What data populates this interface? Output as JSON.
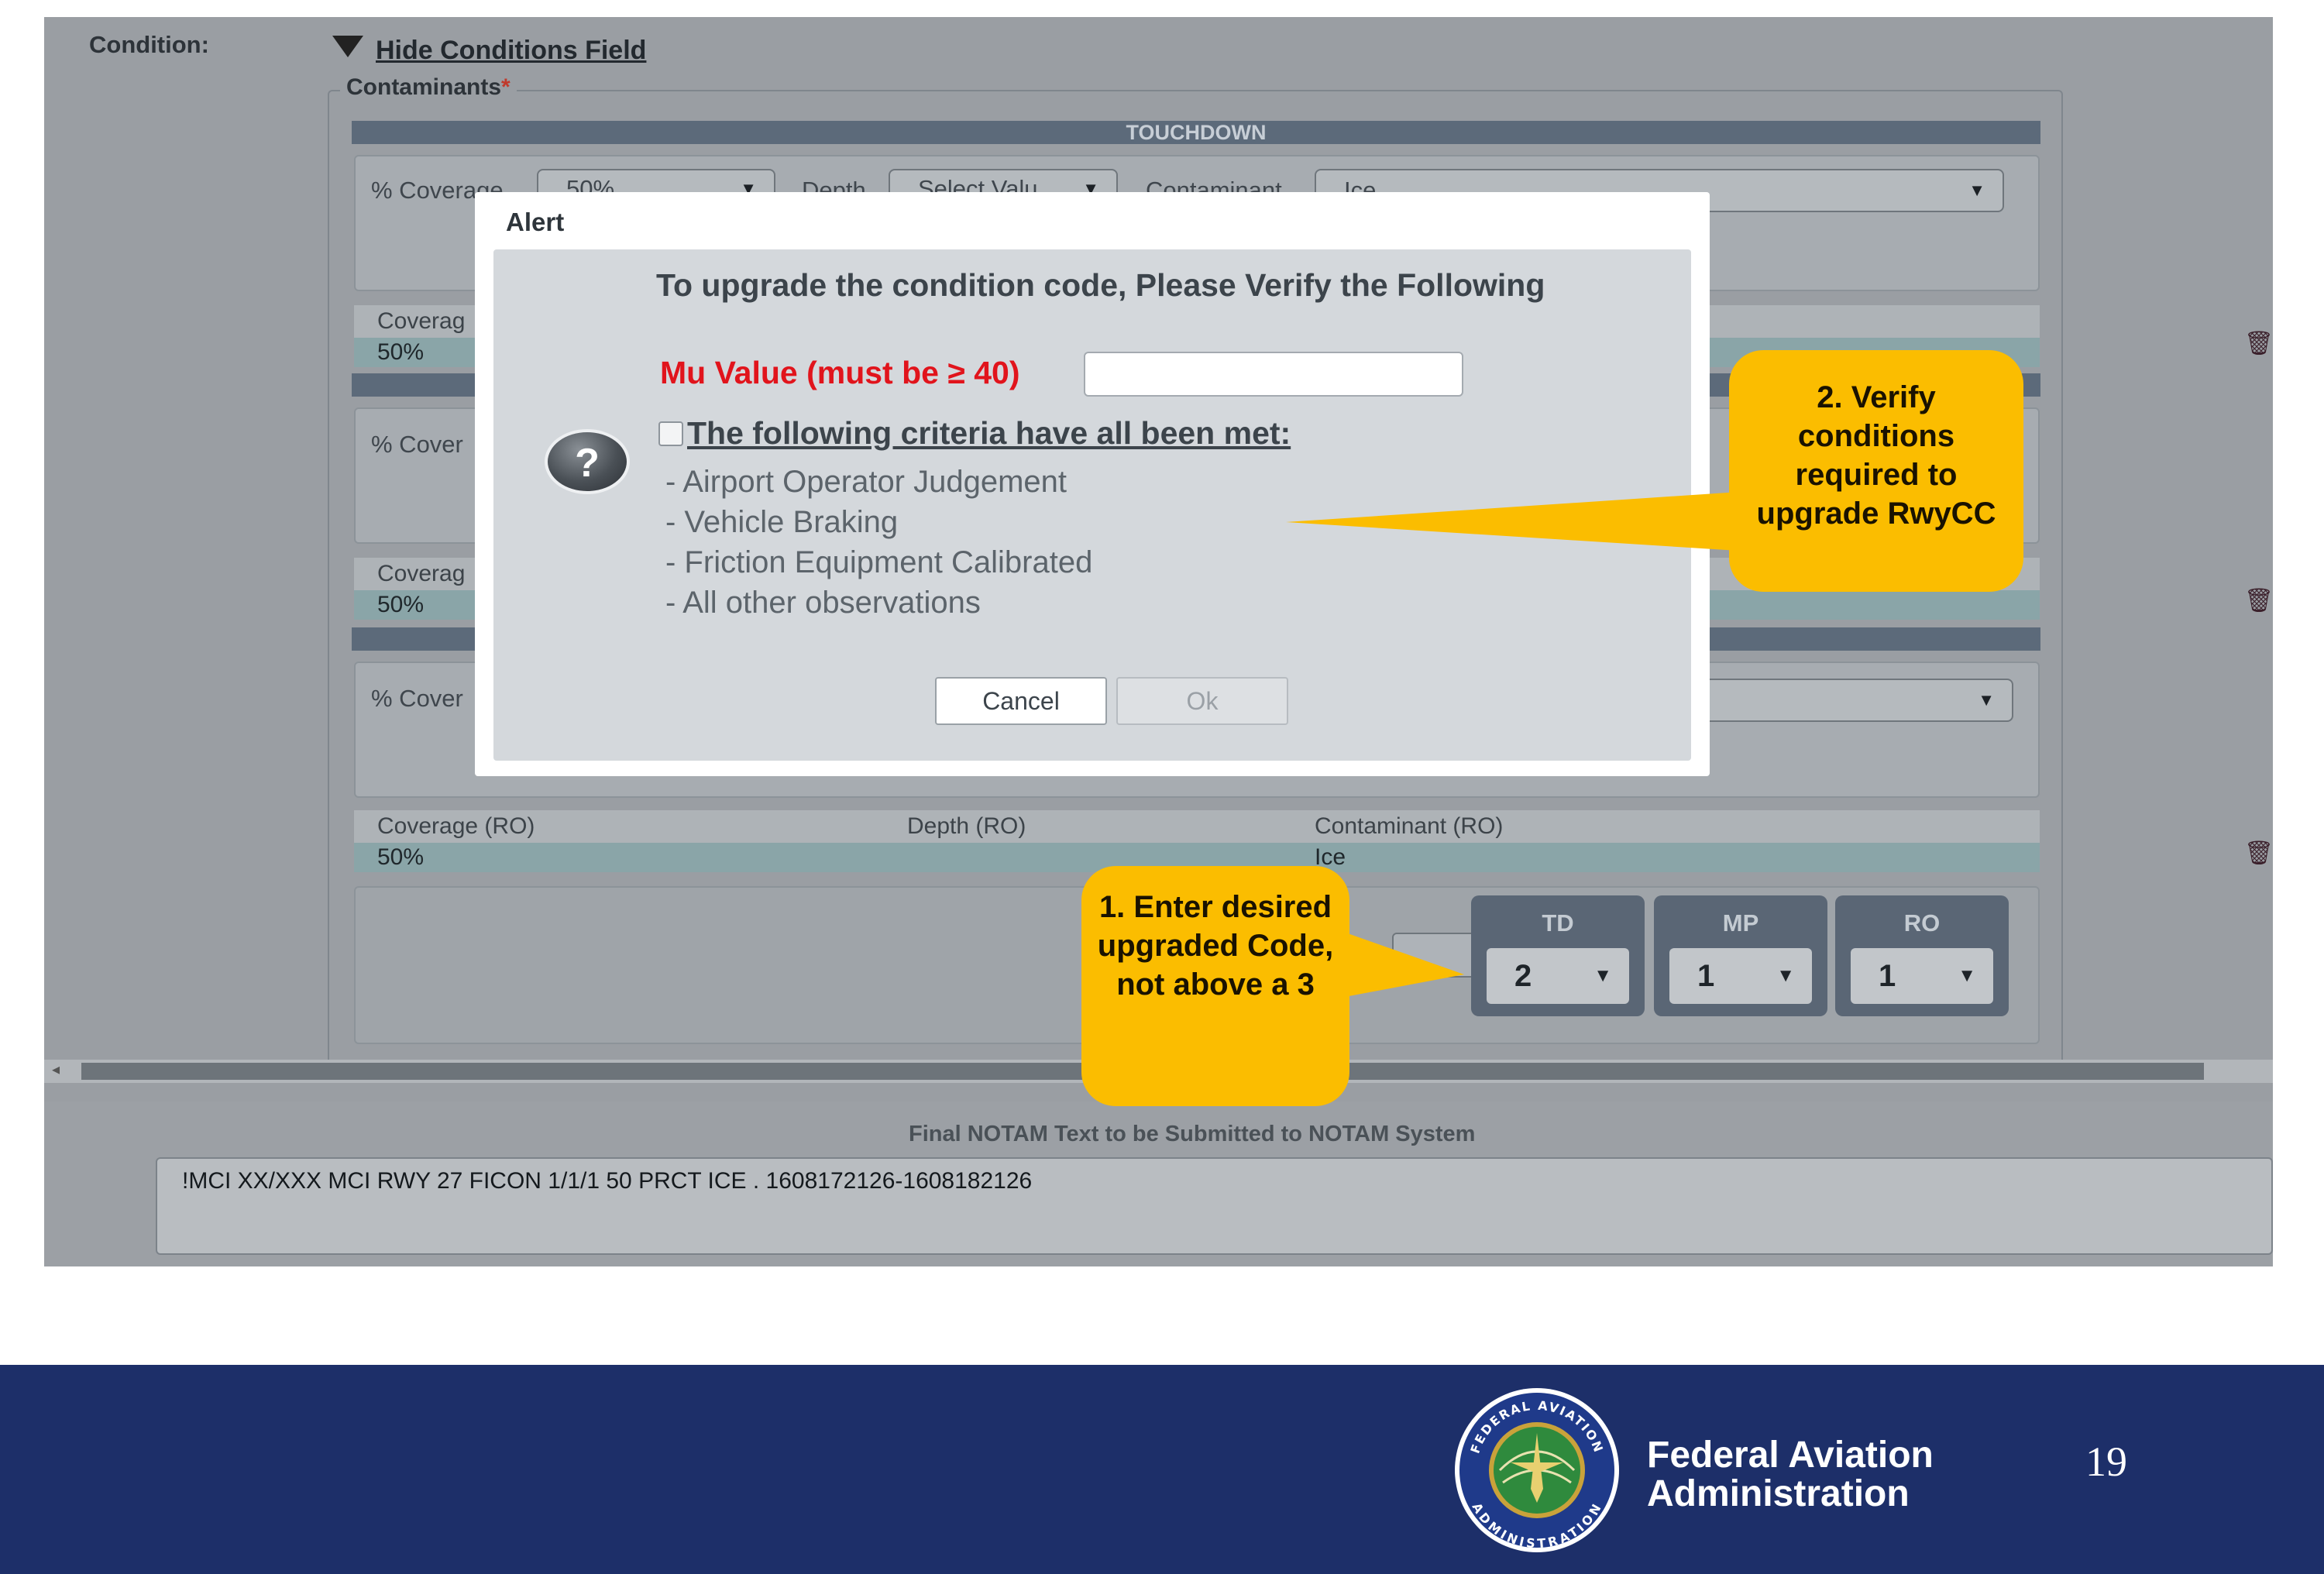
{
  "form": {
    "condition_label": "Condition:",
    "hide_conditions_link": "Hide Conditions Field",
    "contaminants_legend": "Contaminants",
    "required_mark": "*",
    "touchdown_header": "TOUCHDOWN",
    "coverage_label": "% Coverage",
    "coverage_label_partial": "% Cover",
    "coverage_value": "50%",
    "depth_label": "Depth",
    "depth_placeholder": "Select Valu",
    "contaminant_label": "Contaminant",
    "contaminant_value": "Ice",
    "coverage_ro_partial": "Coverag",
    "ro_headers": [
      "Coverage (RO)",
      "Depth (RO)",
      "Contaminant (RO)"
    ],
    "ro_values": [
      "50%",
      "",
      "Ice"
    ],
    "codes": [
      {
        "label": "TD",
        "value": "2"
      },
      {
        "label": "MP",
        "value": "1"
      },
      {
        "label": "RO",
        "value": "1"
      }
    ],
    "final_notam_label": "Final NOTAM Text to be Submitted to NOTAM System",
    "final_notam_text": "!MCI XX/XXX MCI RWY 27 FICON 1/1/1 50 PRCT ICE . 1608172126-1608182126"
  },
  "dialog": {
    "title": "Alert",
    "heading": "To upgrade the condition code, Please Verify the Following",
    "mu_label": "Mu Value (must be ≥ 40)",
    "mu_value": "",
    "criteria_label": "The following criteria have all been met:",
    "criteria": [
      "- Airport Operator Judgement",
      "- Vehicle Braking",
      "- Friction Equipment Calibrated",
      "- All other observations"
    ],
    "cancel_label": "Cancel",
    "ok_label": "Ok"
  },
  "callouts": {
    "verify": "2. Verify conditions required to upgrade RwyCC",
    "enter": "1. Enter desired upgraded Code, not above a 3"
  },
  "footer": {
    "org_line1": "Federal Aviation",
    "org_line2": "Administration",
    "seal_text_top": "FEDERAL AVIATION",
    "seal_text_bottom": "ADMINISTRATION",
    "page_number": "19"
  },
  "colors": {
    "callout": "#fbbd00",
    "footer_bg": "#1d2f69",
    "mu_label": "#e1141c"
  }
}
